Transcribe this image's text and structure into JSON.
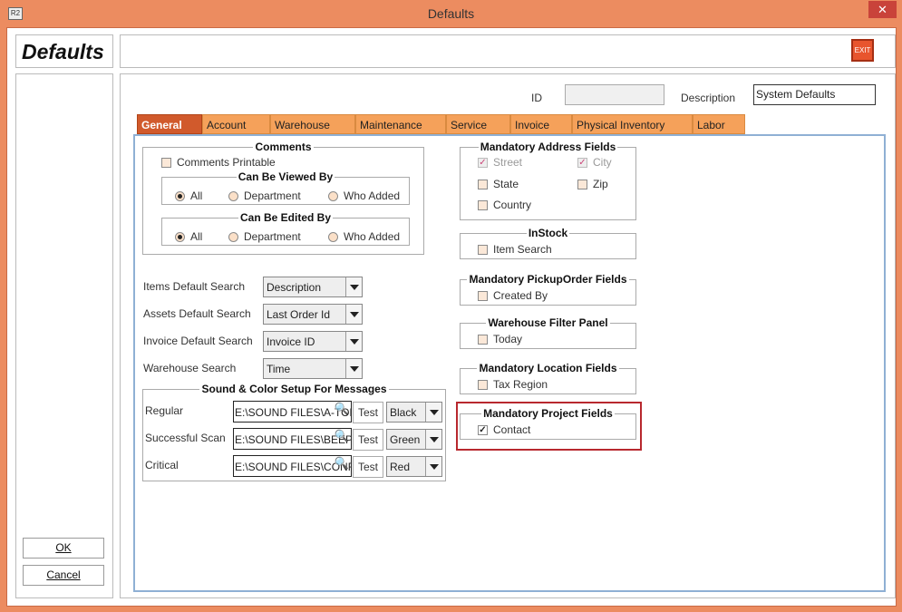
{
  "window": {
    "title": "Defaults",
    "app_icon": "R2",
    "close_glyph": "✕"
  },
  "header": {
    "title": "Defaults",
    "exit_label": "EXIT"
  },
  "side": {
    "ok_label": "OK",
    "cancel_label": "Cancel"
  },
  "form": {
    "id_label": "ID",
    "id_value": "",
    "description_label": "Description",
    "description_value": "System Defaults"
  },
  "tabs": [
    "General",
    "Account",
    "Warehouse",
    "Maintenance",
    "Service",
    "Invoice",
    "Physical Inventory",
    "Labor"
  ],
  "active_tab": "General",
  "comments": {
    "title": "Comments",
    "printable_label": "Comments Printable",
    "printable_checked": false,
    "viewed_by": {
      "title": "Can Be Viewed By",
      "options": [
        "All",
        "Department",
        "Who Added"
      ],
      "selected": "All"
    },
    "edited_by": {
      "title": "Can Be Edited By",
      "options": [
        "All",
        "Department",
        "Who Added"
      ],
      "selected": "All"
    }
  },
  "searches": [
    {
      "label": "Items Default Search",
      "value": "Description"
    },
    {
      "label": "Assets Default Search",
      "value": "Last Order Id"
    },
    {
      "label": "Invoice Default Search",
      "value": "Invoice ID"
    },
    {
      "label": "Warehouse Search",
      "value": "Time"
    }
  ],
  "sound": {
    "title": "Sound & Color Setup For Messages",
    "test_label": "Test",
    "rows": [
      {
        "label": "Regular",
        "path": "E:\\SOUND FILES\\A-TON",
        "color": "Black"
      },
      {
        "label": "Successful Scan",
        "path": "E:\\SOUND FILES\\BEEP",
        "color": "Green"
      },
      {
        "label": "Critical",
        "path": "E:\\SOUND FILES\\CONF",
        "color": "Red"
      }
    ]
  },
  "mandatory_address": {
    "title": "Mandatory Address Fields",
    "street": "Street",
    "city": "City",
    "state": "State",
    "zip": "Zip",
    "country": "Country"
  },
  "instock": {
    "title": "InStock",
    "item_search": "Item Search"
  },
  "pickup": {
    "title": "Mandatory PickupOrder Fields",
    "created_by": "Created By"
  },
  "warehouse_filter": {
    "title": "Warehouse Filter Panel",
    "today": "Today"
  },
  "location": {
    "title": "Mandatory Location Fields",
    "tax_region": "Tax Region"
  },
  "project": {
    "title": "Mandatory Project Fields",
    "contact": "Contact",
    "contact_checked": true
  },
  "colors": {
    "title_bar": "#ec8c60",
    "active_tab": "#d15a2c",
    "tab": "#f5a15a",
    "highlight": "#b8282e"
  }
}
